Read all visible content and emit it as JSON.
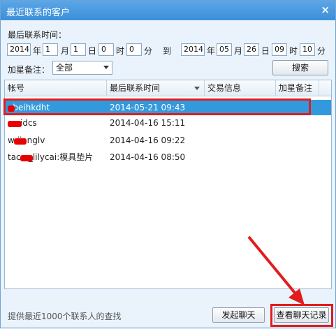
{
  "window": {
    "title": "最近联系的客户",
    "close_glyph": "×"
  },
  "filters": {
    "time_label": "最后联系时间：",
    "from": {
      "year": "2014",
      "month": "1",
      "day": "1",
      "hour": "0",
      "minute": "0"
    },
    "to": {
      "year": "2014",
      "month": "05",
      "day": "26",
      "hour": "09",
      "minute": "10"
    },
    "unit_year": "年",
    "unit_month": "月",
    "unit_day": "日",
    "unit_hour": "时",
    "unit_minute": "分",
    "to_label": "到",
    "star_label": "加星备注：",
    "star_selected": "全部",
    "search_button": "搜索"
  },
  "table": {
    "columns": [
      "帐号",
      "最后联系时间",
      "交易信息",
      "加星备注"
    ],
    "rows": [
      {
        "account": "ebeihkdht",
        "time": "2014-05-21 09:43",
        "selected": true
      },
      {
        "account": "idcs",
        "time": "2014-04-16 15:11",
        "selected": false
      },
      {
        "account": "w iianglv",
        "time": "2014-04-16 09:22",
        "selected": false
      },
      {
        "account": "tac o_lilycai:模具垫片",
        "time": "2014-04-16 08:50",
        "selected": false
      }
    ]
  },
  "footer": {
    "hint": "提供最近1000个联系人的查找",
    "start_chat_button": "发起聊天",
    "view_history_button": "查看聊天记录"
  },
  "colors": {
    "highlight": "#e21c1c",
    "selection": "#3399dd"
  }
}
